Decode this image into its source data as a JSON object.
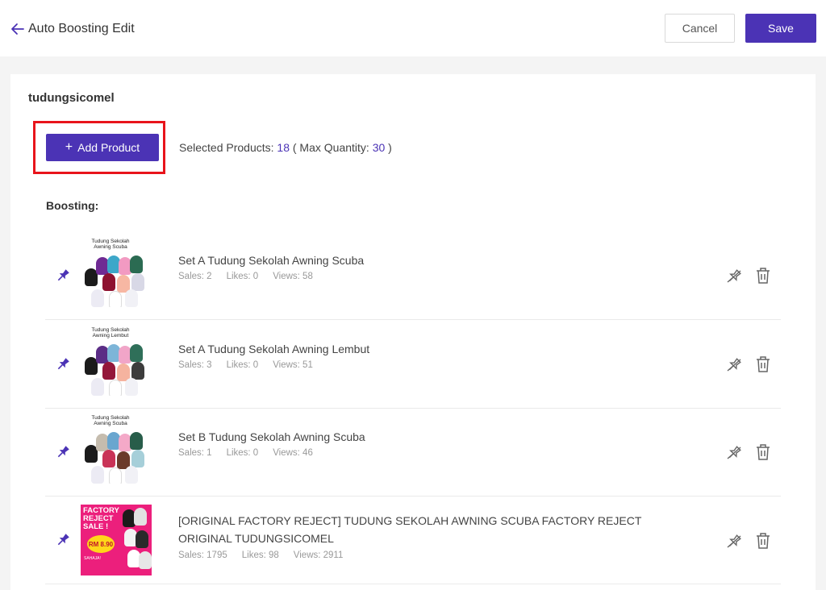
{
  "header": {
    "title": "Auto Boosting Edit",
    "cancel_label": "Cancel",
    "save_label": "Save"
  },
  "store": {
    "name": "tudungsicomel"
  },
  "toolbar": {
    "add_plus": "+",
    "add_label": "Add Product",
    "selected_label": "Selected Products: ",
    "selected_count": "18",
    "max_label": " ( Max Quantity: ",
    "max_count": "30",
    "max_close": " )"
  },
  "boosting_label": "Boosting:",
  "colors": {
    "accent": "#4b33b5",
    "highlight": "#e8141b"
  },
  "products": [
    {
      "name": "Set A Tudung Sekolah Awning Scuba",
      "sales": "Sales: 2",
      "likes": "Likes: 0",
      "views": "Views: 58",
      "thumb_caption": "Tudung Sekolah Awning Scuba"
    },
    {
      "name": "Set A Tudung Sekolah Awning Lembut",
      "sales": "Sales: 3",
      "likes": "Likes: 0",
      "views": "Views: 51",
      "thumb_caption": "Tudung Sekolah Awning Lembut"
    },
    {
      "name": "Set B Tudung Sekolah Awning Scuba",
      "sales": "Sales: 1",
      "likes": "Likes: 0",
      "views": "Views: 46",
      "thumb_caption": "Tudung Sekolah Awning Scuba"
    },
    {
      "name": "[ORIGINAL FACTORY REJECT] TUDUNG SEKOLAH AWNING SCUBA FACTORY REJECT ORIGINAL TUDUNGSICOMEL",
      "sales": "Sales: 1795",
      "likes": "Likes: 98",
      "views": "Views: 2911",
      "thumb_title": "FACTORY REJECT SALE !",
      "thumb_price": "RM 8.90",
      "thumb_sub": "SAHAJA!"
    }
  ]
}
